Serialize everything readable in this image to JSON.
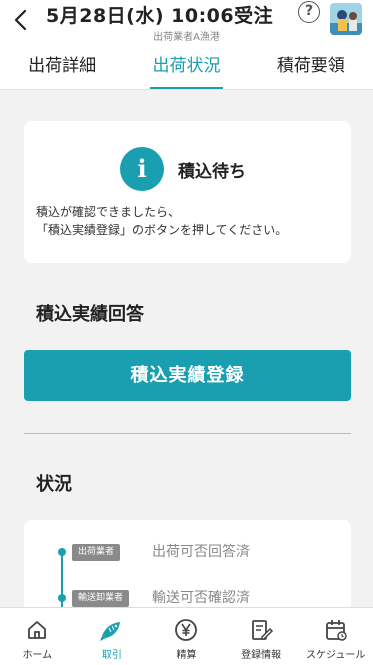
{
  "header": {
    "title": "5月28日(水) 10:06受注",
    "subtitle": "出荷業者A漁港",
    "help_label": "?"
  },
  "tabs": [
    {
      "label": "出荷詳細",
      "active": false
    },
    {
      "label": "出荷状況",
      "active": true
    },
    {
      "label": "積荷要領",
      "active": false
    }
  ],
  "status_card": {
    "icon_label": "i",
    "title": "積込待ち",
    "message_line1": "積込が確認できましたら、",
    "message_line2": "「積込実績登録」のボタンを押してください。"
  },
  "loading_section": {
    "heading": "積込実績回答",
    "button_label": "積込実績登録"
  },
  "status_section": {
    "heading": "状況",
    "timeline": [
      {
        "badge": "出荷業者",
        "text": "出荷可否回答済"
      },
      {
        "badge": "輸送卸業者",
        "text": "輸送可否確認済"
      }
    ]
  },
  "bottom_nav": [
    {
      "label": "ホーム",
      "icon": "home-icon",
      "active": false
    },
    {
      "label": "取引",
      "icon": "fish-icon",
      "active": true
    },
    {
      "label": "精算",
      "icon": "yen-icon",
      "active": false
    },
    {
      "label": "登録情報",
      "icon": "document-edit-icon",
      "active": false
    },
    {
      "label": "スケジュール",
      "icon": "calendar-icon",
      "active": false
    }
  ],
  "colors": {
    "accent": "#1a9fb0",
    "background": "#f2f2f2",
    "badge": "#8a8a8a"
  }
}
